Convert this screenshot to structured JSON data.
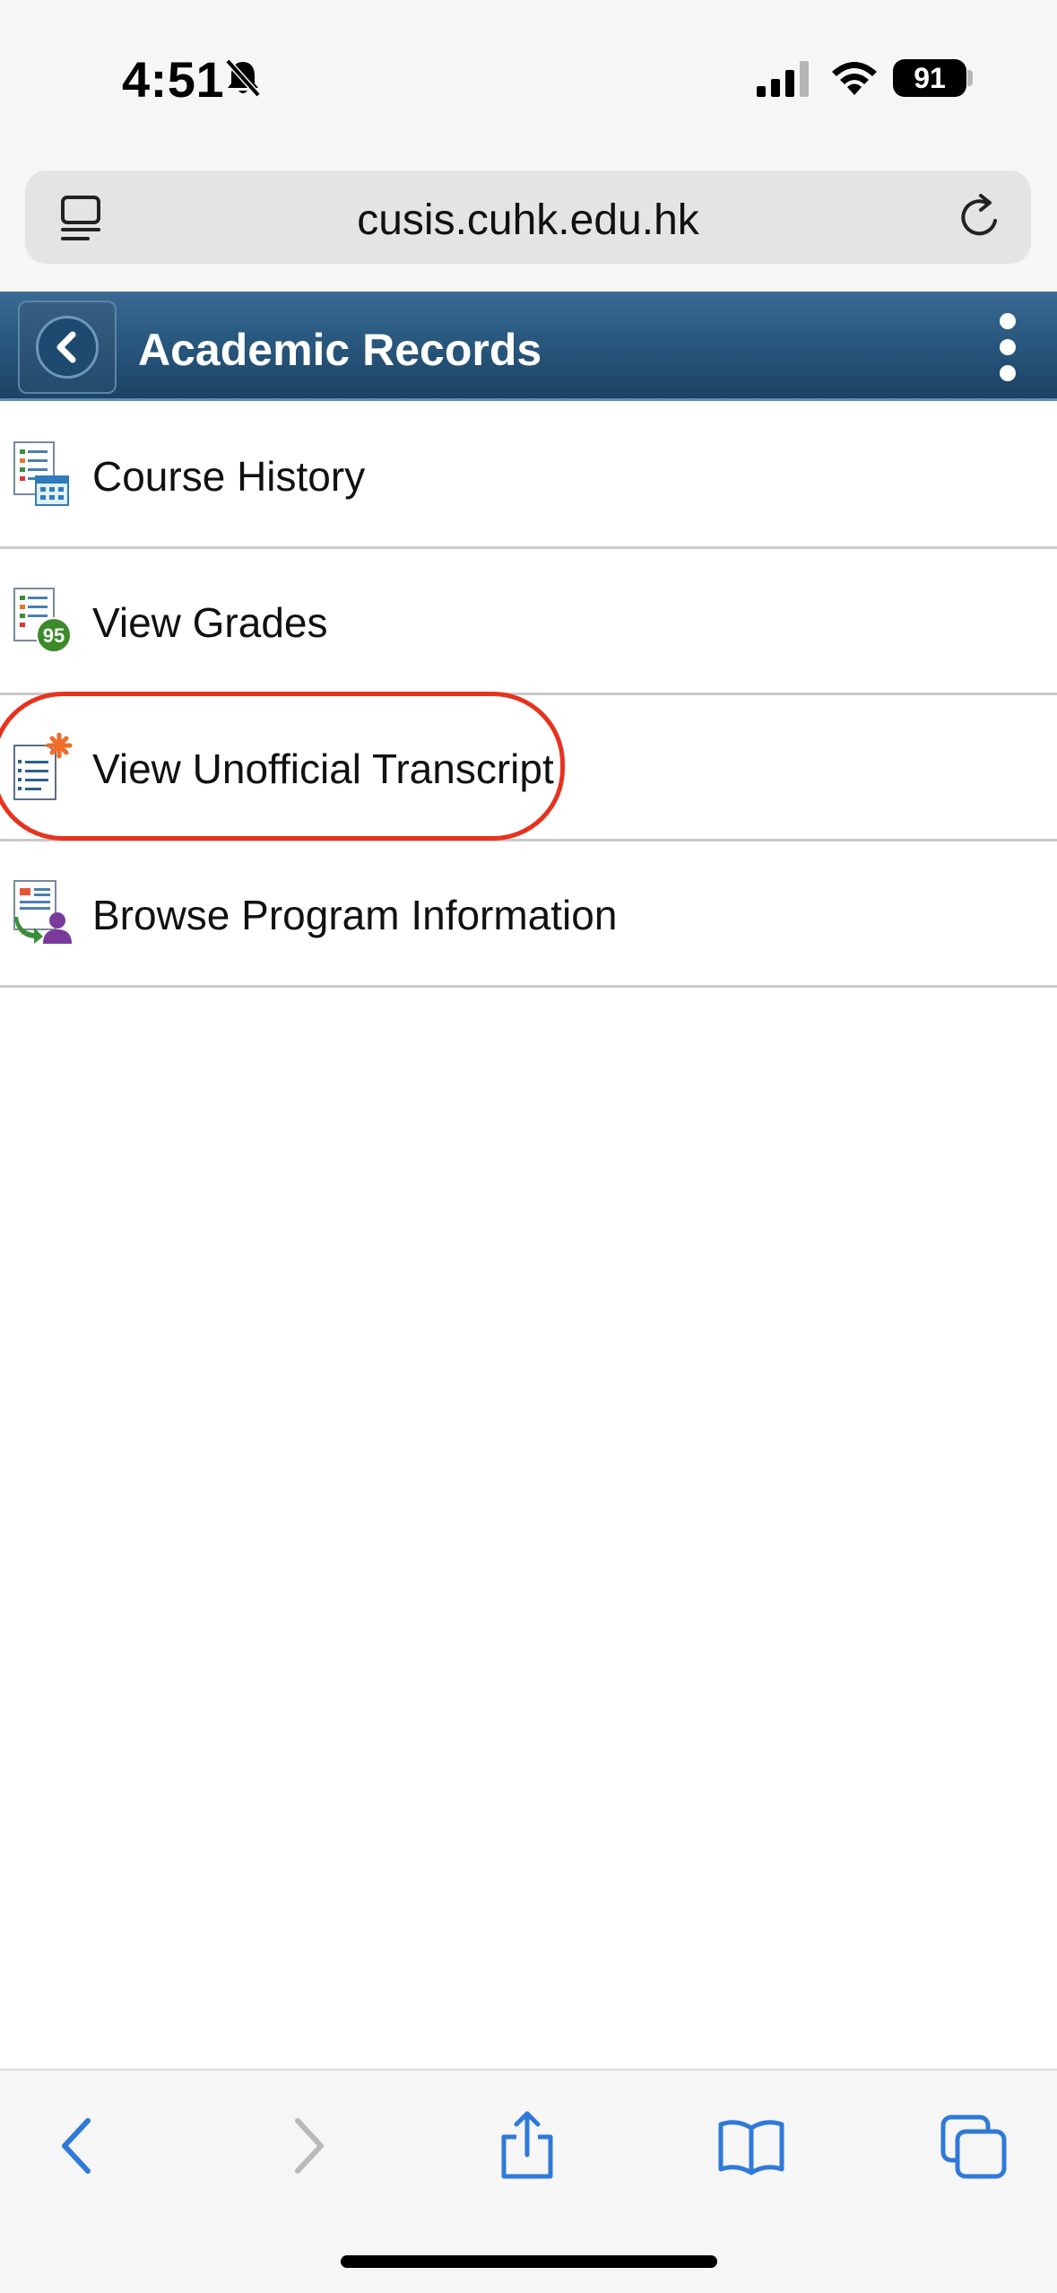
{
  "status_bar": {
    "time": "4:51",
    "battery": "91"
  },
  "browser": {
    "url": "cusis.cuhk.edu.hk"
  },
  "header": {
    "title": "Academic Records"
  },
  "menu": {
    "items": [
      {
        "label": "Course History",
        "icon": "course-history-icon"
      },
      {
        "label": "View Grades",
        "icon": "view-grades-icon",
        "badge": "95"
      },
      {
        "label": "View Unofficial Transcript",
        "icon": "transcript-icon"
      },
      {
        "label": "Browse Program Information",
        "icon": "program-info-icon"
      }
    ]
  },
  "colors": {
    "header_top": "#3a6a93",
    "header_bottom": "#1c4364",
    "highlight_ring": "#e8321e",
    "ios_blue": "#2f7ad9"
  }
}
